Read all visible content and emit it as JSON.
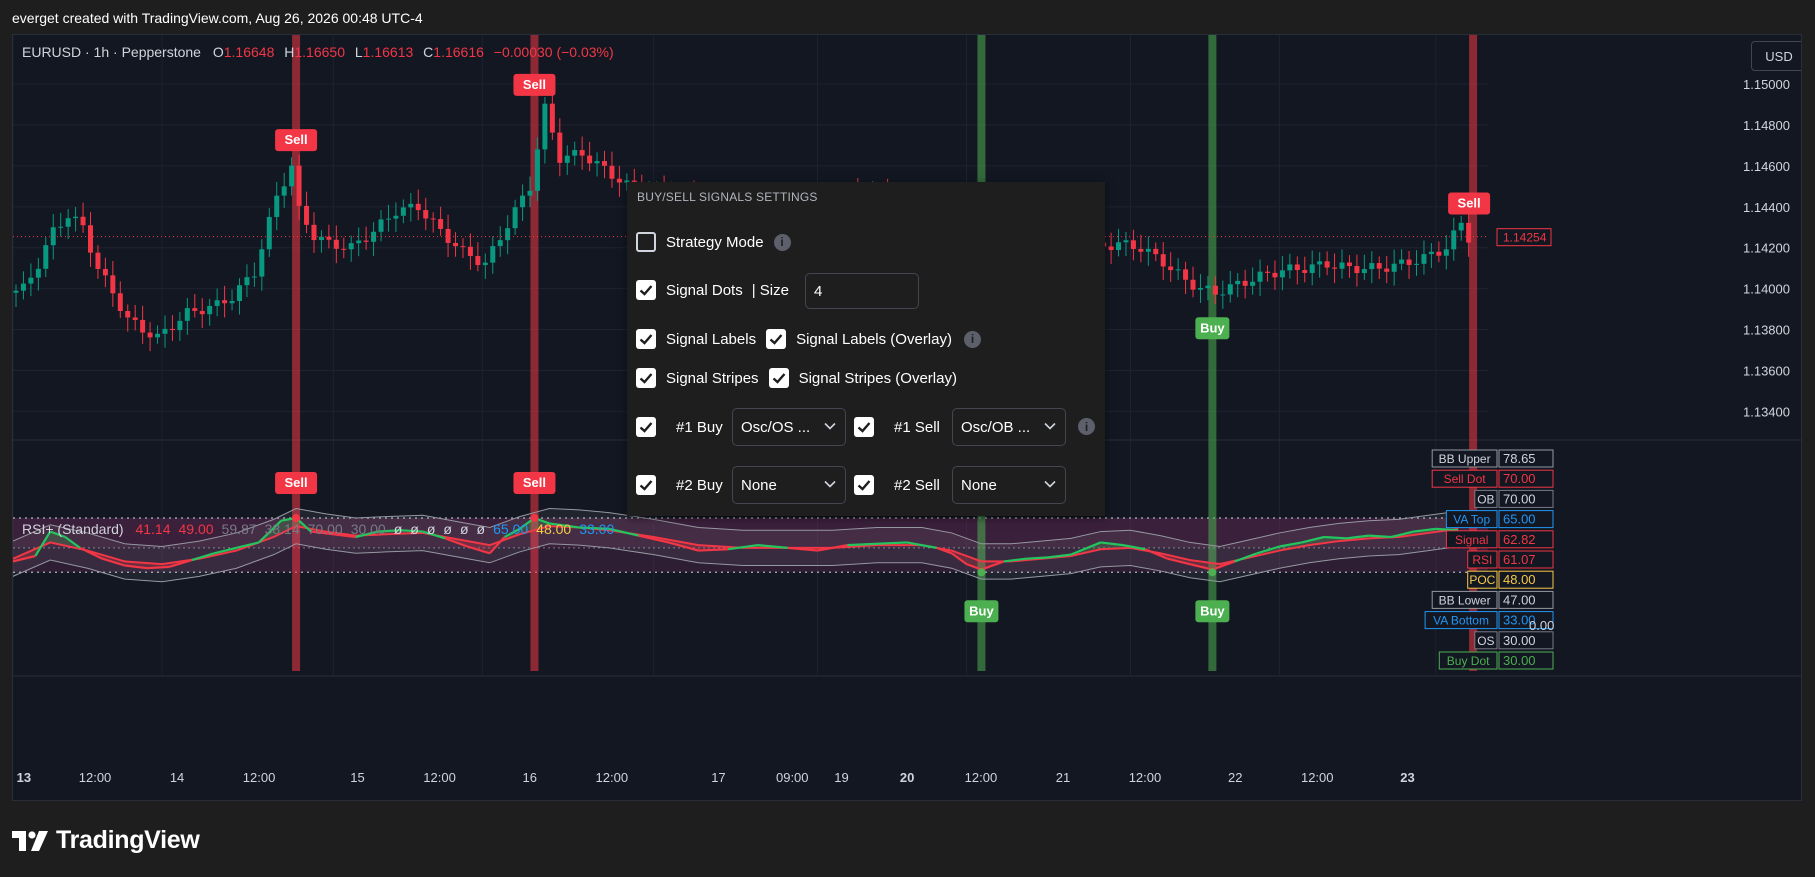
{
  "header": {
    "text": "everget created with TradingView.com, Aug 26, 2026 00:48 UTC-4"
  },
  "legend": {
    "symbol": "EURUSD · 1h · Pepperstone",
    "o_label": "O",
    "o_value": "1.16648",
    "h_label": "H",
    "h_value": "1.16650",
    "l_label": "L",
    "l_value": "1.16613",
    "c_label": "C",
    "c_value": "1.16616",
    "change": "−0.00030 (−0.03%)"
  },
  "currency_button": "USD",
  "price_scale": {
    "ticks": [
      "1.15000",
      "1.14800",
      "1.14600",
      "1.14400",
      "1.14200",
      "1.14000",
      "1.13800",
      "1.13600",
      "1.13400"
    ],
    "last_price": "1.14254"
  },
  "rsi_legend": {
    "name": "RSI+ (Standard)",
    "values": [
      "41.14",
      "49.00",
      "59.87",
      "38.14",
      "70.00",
      "30.00",
      "ø",
      "ø",
      "ø",
      "ø",
      "ø",
      "ø",
      "65.00",
      "48.00",
      "33.00"
    ]
  },
  "rsi_labels": [
    {
      "name": "BB Upper",
      "value": "78.65"
    },
    {
      "name": "Sell Dot",
      "value": "70.00"
    },
    {
      "name": "OB",
      "value": "70.00"
    },
    {
      "name": "VA Top",
      "value": "65.00"
    },
    {
      "name": "Signal",
      "value": "62.82"
    },
    {
      "name": "RSI",
      "value": "61.07"
    },
    {
      "name": "POC",
      "value": "48.00"
    },
    {
      "name": "BB Lower",
      "value": "47.00"
    },
    {
      "name": "VA Bottom",
      "value": "33.00"
    },
    {
      "name": "OS",
      "value": "30.00"
    },
    {
      "name": "Buy Dot",
      "value": "30.00"
    }
  ],
  "rsi_zero": "0.00",
  "time_axis": [
    "13",
    "12:00",
    "14",
    "12:00",
    "15",
    "12:00",
    "16",
    "12:00",
    "17",
    "09:00",
    "19",
    "20",
    "12:00",
    "21",
    "12:00",
    "22",
    "12:00",
    "23"
  ],
  "signals": {
    "sell": "Sell",
    "buy": "Buy"
  },
  "panel": {
    "title": "BUY/SELL SIGNALS SETTINGS",
    "strategy_mode": "Strategy Mode",
    "signal_dots": "Signal Dots",
    "size_label": "| Size",
    "size_value": "4",
    "signal_labels": "Signal Labels",
    "signal_labels_overlay": "Signal Labels (Overlay)",
    "signal_stripes": "Signal Stripes",
    "signal_stripes_overlay": "Signal Stripes (Overlay)",
    "buy1_label": "#1 Buy",
    "buy1_value": "Osc/OS ...",
    "sell1_label": "#1 Sell",
    "sell1_value": "Osc/OB ...",
    "buy2_label": "#2 Buy",
    "buy2_value": "None",
    "sell2_label": "#2 Sell",
    "sell2_value": "None"
  },
  "footer": {
    "brand": "TradingView"
  },
  "colors": {
    "up": "#089981",
    "down": "#f23645",
    "buy": "#4caf50",
    "sell": "#f23645",
    "rsi_fill": "#6b2d5c"
  },
  "chart_data": [
    {
      "type": "candlestick",
      "title": "EURUSD · 1h · Pepperstone",
      "ylim": [
        1.1326,
        1.1524
      ],
      "y_ticks": [
        1.15,
        1.148,
        1.146,
        1.144,
        1.142,
        1.14,
        1.138,
        1.136,
        1.134
      ],
      "last_price": 1.14254,
      "close_series": [
        [
          0,
          1.1398
        ],
        [
          2,
          1.14
        ],
        [
          4,
          1.1412
        ],
        [
          6,
          1.1428
        ],
        [
          8,
          1.1436
        ],
        [
          10,
          1.143
        ],
        [
          12,
          1.141
        ],
        [
          14,
          1.1398
        ],
        [
          16,
          1.1385
        ],
        [
          18,
          1.138
        ],
        [
          20,
          1.1376
        ],
        [
          22,
          1.1382
        ],
        [
          24,
          1.1388
        ],
        [
          26,
          1.139
        ],
        [
          28,
          1.1392
        ],
        [
          30,
          1.1396
        ],
        [
          33,
          1.1408
        ],
        [
          36,
          1.1445
        ],
        [
          38,
          1.146
        ],
        [
          39,
          1.1438
        ],
        [
          41,
          1.1426
        ],
        [
          43,
          1.1422
        ],
        [
          46,
          1.142
        ],
        [
          49,
          1.1428
        ],
        [
          52,
          1.1438
        ],
        [
          55,
          1.144
        ],
        [
          58,
          1.1428
        ],
        [
          61,
          1.1418
        ],
        [
          64,
          1.1412
        ],
        [
          66,
          1.1425
        ],
        [
          68,
          1.1438
        ],
        [
          70,
          1.145
        ],
        [
          72,
          1.1488
        ],
        [
          74,
          1.1464
        ],
        [
          77,
          1.1466
        ],
        [
          84,
          1.1448
        ],
        [
          90,
          1.1445
        ],
        [
          96,
          1.144
        ],
        [
          102,
          1.1442
        ],
        [
          108,
          1.1444
        ],
        [
          114,
          1.1446
        ],
        [
          120,
          1.1445
        ],
        [
          124,
          1.1441
        ],
        [
          126,
          1.1434
        ],
        [
          128,
          1.1422
        ],
        [
          129,
          1.1408
        ],
        [
          130,
          1.1408
        ],
        [
          133,
          1.141
        ],
        [
          136,
          1.1412
        ],
        [
          139,
          1.141
        ],
        [
          142,
          1.1414
        ],
        [
          146,
          1.142
        ],
        [
          149,
          1.1422
        ],
        [
          152,
          1.142
        ],
        [
          155,
          1.1413
        ],
        [
          158,
          1.1404
        ],
        [
          160,
          1.14
        ],
        [
          162,
          1.1398
        ],
        [
          165,
          1.1402
        ],
        [
          168,
          1.1406
        ],
        [
          171,
          1.1409
        ],
        [
          174,
          1.141
        ],
        [
          177,
          1.1412
        ],
        [
          180,
          1.141
        ],
        [
          184,
          1.141
        ],
        [
          187,
          1.1412
        ],
        [
          190,
          1.1415
        ],
        [
          193,
          1.142
        ],
        [
          195,
          1.1432
        ],
        [
          196,
          1.1425
        ]
      ]
    },
    {
      "type": "line",
      "title": "RSI+ (Standard)",
      "ylim": [
        0,
        100
      ],
      "levels": {
        "OB": 70,
        "OS": 30,
        "VA Top": 65,
        "POC": 48,
        "VA Bottom": 33,
        "BB Upper": 78.65,
        "BB Lower": 47
      },
      "series": [
        {
          "name": "RSI",
          "values": [
            [
              0,
              38
            ],
            [
              3,
              42
            ],
            [
              5,
              60
            ],
            [
              7,
              56
            ],
            [
              9,
              48
            ],
            [
              12,
              40
            ],
            [
              15,
              35
            ],
            [
              18,
              33
            ],
            [
              21,
              34
            ],
            [
              24,
              39
            ],
            [
              27,
              44
            ],
            [
              30,
              48
            ],
            [
              33,
              52
            ],
            [
              36,
              68
            ],
            [
              38,
              70
            ],
            [
              40,
              60
            ],
            [
              43,
              58
            ],
            [
              46,
              56
            ],
            [
              49,
              60
            ],
            [
              52,
              61
            ],
            [
              55,
              60
            ],
            [
              58,
              55
            ],
            [
              61,
              49
            ],
            [
              64,
              44
            ],
            [
              66,
              56
            ],
            [
              68,
              62
            ],
            [
              70,
              70
            ],
            [
              72,
              66
            ],
            [
              76,
              63
            ],
            [
              80,
              62
            ],
            [
              84,
              57
            ],
            [
              88,
              52
            ],
            [
              92,
              46
            ],
            [
              96,
              47
            ],
            [
              100,
              50
            ],
            [
              104,
              48
            ],
            [
              108,
              46
            ],
            [
              112,
              50
            ],
            [
              116,
              51
            ],
            [
              120,
              52
            ],
            [
              124,
              48
            ],
            [
              126,
              44
            ],
            [
              128,
              36
            ],
            [
              130,
              32
            ],
            [
              133,
              38
            ],
            [
              136,
              40
            ],
            [
              139,
              41
            ],
            [
              142,
              43
            ],
            [
              146,
              52
            ],
            [
              149,
              50
            ],
            [
              152,
              47
            ],
            [
              155,
              40
            ],
            [
              158,
              36
            ],
            [
              161,
              32
            ],
            [
              164,
              38
            ],
            [
              167,
              44
            ],
            [
              170,
              49
            ],
            [
              173,
              52
            ],
            [
              176,
              56
            ],
            [
              179,
              55
            ],
            [
              182,
              57
            ],
            [
              185,
              56
            ],
            [
              188,
              60
            ],
            [
              191,
              62
            ],
            [
              194,
              61
            ]
          ]
        },
        {
          "name": "Signal",
          "values": [
            [
              0,
              40
            ],
            [
              5,
              52
            ],
            [
              10,
              46
            ],
            [
              15,
              38
            ],
            [
              20,
              36
            ],
            [
              25,
              40
            ],
            [
              30,
              46
            ],
            [
              35,
              56
            ],
            [
              38,
              64
            ],
            [
              42,
              60
            ],
            [
              46,
              57
            ],
            [
              50,
              58
            ],
            [
              55,
              59
            ],
            [
              60,
              54
            ],
            [
              64,
              50
            ],
            [
              68,
              58
            ],
            [
              72,
              64
            ],
            [
              76,
              63
            ],
            [
              80,
              61
            ],
            [
              86,
              56
            ],
            [
              92,
              50
            ],
            [
              98,
              48
            ],
            [
              104,
              48
            ],
            [
              110,
              48
            ],
            [
              116,
              50
            ],
            [
              122,
              50
            ],
            [
              126,
              46
            ],
            [
              130,
              38
            ],
            [
              134,
              38
            ],
            [
              138,
              40
            ],
            [
              142,
              42
            ],
            [
              146,
              47
            ],
            [
              150,
              48
            ],
            [
              154,
              44
            ],
            [
              158,
              39
            ],
            [
              162,
              36
            ],
            [
              166,
              41
            ],
            [
              170,
              46
            ],
            [
              174,
              50
            ],
            [
              178,
              53
            ],
            [
              182,
              55
            ],
            [
              186,
              56
            ],
            [
              190,
              59
            ],
            [
              194,
              62
            ]
          ]
        }
      ],
      "signals": [
        {
          "x": 38,
          "label": "Sell"
        },
        {
          "x": 70,
          "label": "Sell"
        },
        {
          "x": 130,
          "label": "Buy"
        },
        {
          "x": 161,
          "label": "Buy"
        },
        {
          "x": 196,
          "label": "Sell"
        }
      ]
    }
  ]
}
